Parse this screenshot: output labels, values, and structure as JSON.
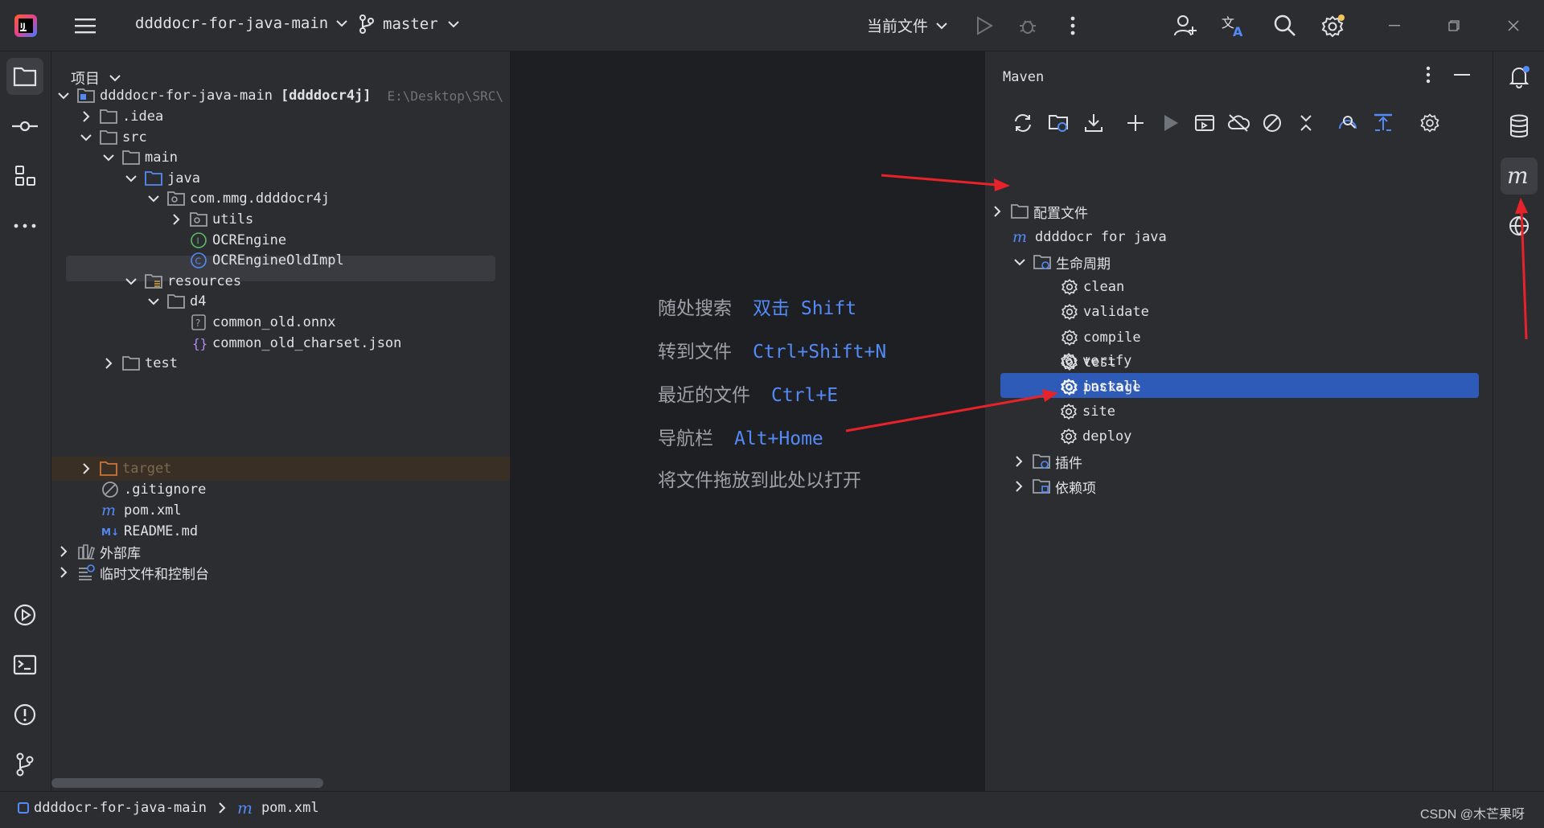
{
  "titlebar": {
    "project_name": "ddddocr-for-java-main",
    "branch": "master",
    "run_config": "当前文件"
  },
  "project_panel": {
    "title": "项目",
    "tree": [
      {
        "label": "ddddocr-for-java-main",
        "module": "[ddddocr4j]",
        "path": "E:\\Desktop\\SRC\\"
      },
      {
        "label": ".idea"
      },
      {
        "label": "src"
      },
      {
        "label": "main"
      },
      {
        "label": "java"
      },
      {
        "label": "com.mmg.ddddocr4j"
      },
      {
        "label": "utils"
      },
      {
        "label": "OCREngine"
      },
      {
        "label": "OCREngineOldImpl"
      },
      {
        "label": "resources"
      },
      {
        "label": "d4"
      },
      {
        "label": "common_old.onnx"
      },
      {
        "label": "common_old_charset.json"
      },
      {
        "label": "test"
      },
      {
        "label": "target"
      },
      {
        "label": ".gitignore"
      },
      {
        "label": "pom.xml"
      },
      {
        "label": "README.md"
      },
      {
        "label": "外部库"
      },
      {
        "label": "临时文件和控制台"
      }
    ]
  },
  "editor": {
    "hints": [
      {
        "text": "随处搜索",
        "key": "双击 Shift"
      },
      {
        "text": "转到文件",
        "key": "Ctrl+Shift+N"
      },
      {
        "text": "最近的文件",
        "key": "Ctrl+E"
      },
      {
        "text": "导航栏",
        "key": "Alt+Home"
      },
      {
        "text": "将文件拖放到此处以打开",
        "key": ""
      }
    ]
  },
  "maven_panel": {
    "title": "Maven",
    "tree": [
      {
        "label": "配置文件"
      },
      {
        "label": "ddddocr for java"
      },
      {
        "label": "生命周期"
      },
      {
        "label": "clean"
      },
      {
        "label": "validate"
      },
      {
        "label": "compile"
      },
      {
        "label": "test"
      },
      {
        "label": "package"
      },
      {
        "label": "verify"
      },
      {
        "label": "install"
      },
      {
        "label": "site"
      },
      {
        "label": "deploy"
      },
      {
        "label": "插件"
      },
      {
        "label": "依赖项"
      }
    ]
  },
  "statusbar": {
    "crumb_project": "ddddocr-for-java-main",
    "crumb_file": "pom.xml",
    "watermark": "CSDN @木芒果呀"
  },
  "colors": {
    "accent": "#2e5bb8",
    "key_blue": "#548af7",
    "annotation_red": "#e8222a"
  }
}
